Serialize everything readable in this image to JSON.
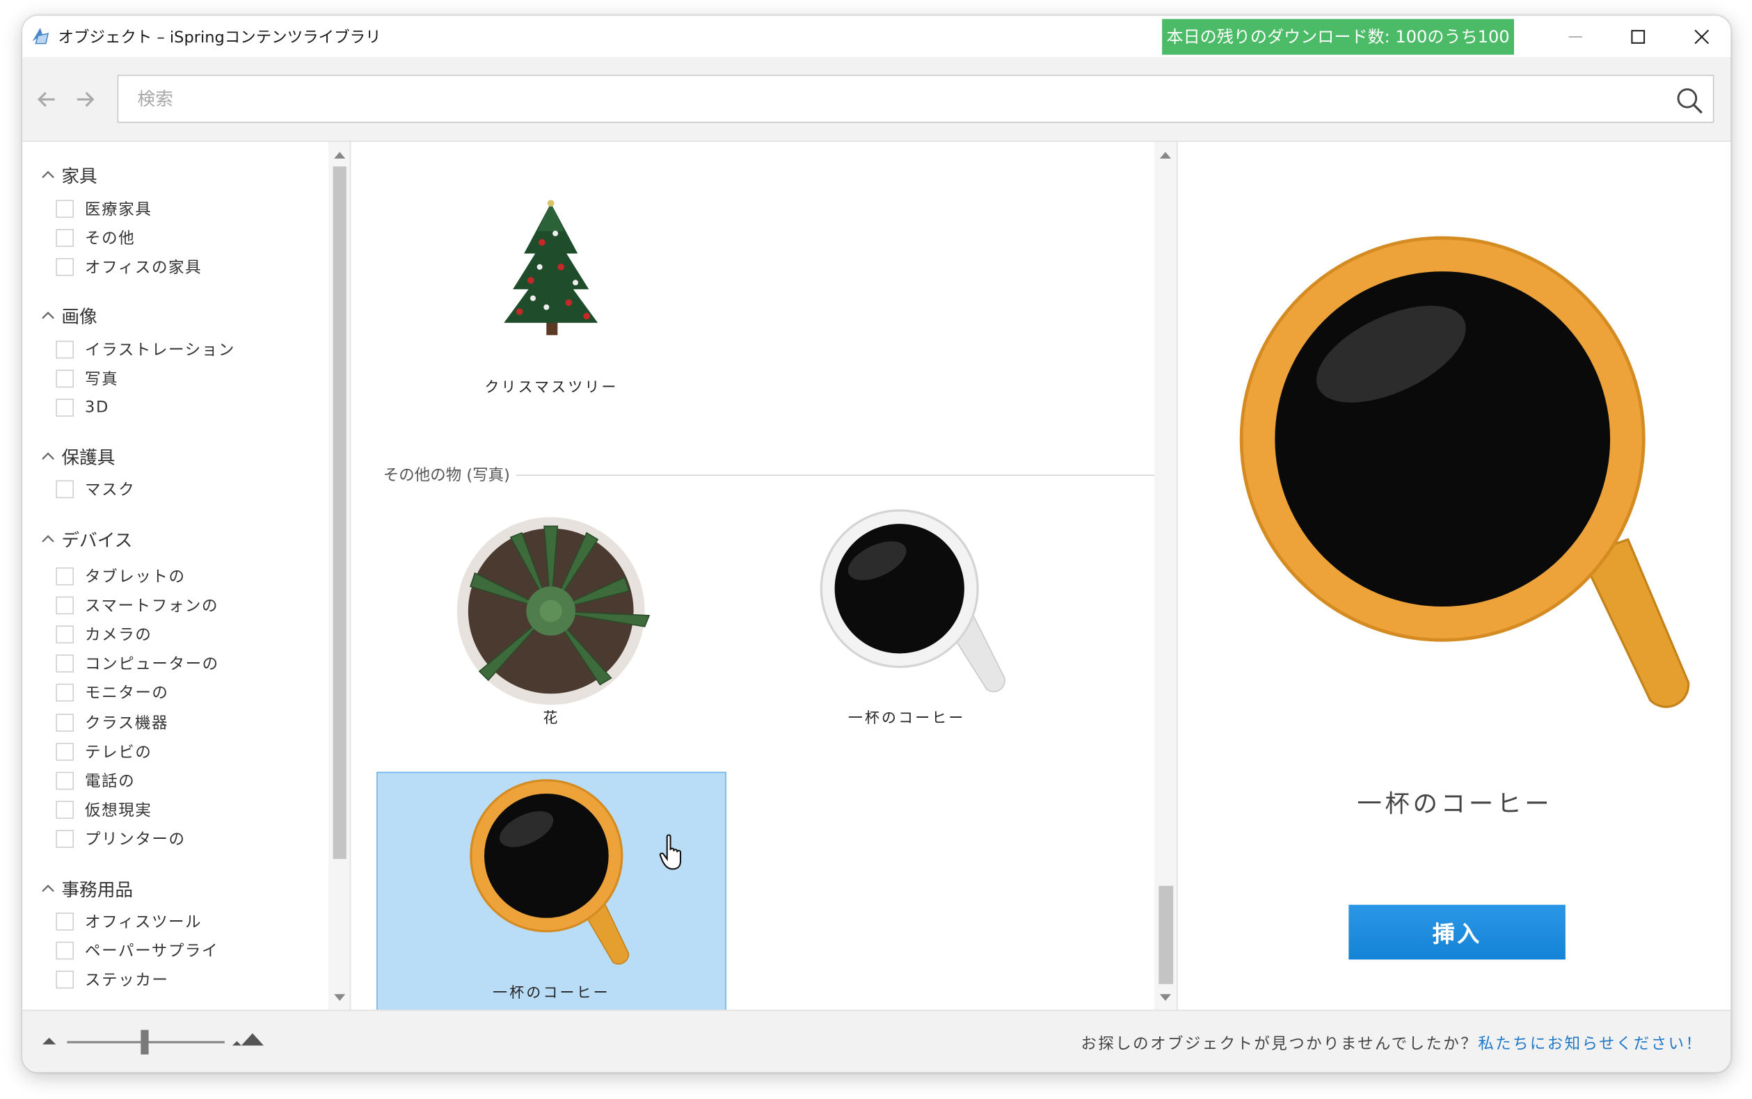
{
  "window": {
    "title": "オブジェクト – iSpringコンテンツライブラリ",
    "download_badge": "本日の残りのダウンロード数: 100のうち100"
  },
  "search": {
    "placeholder": "検索",
    "value": ""
  },
  "sidebar": {
    "categories": [
      {
        "label": "家具",
        "items": [
          "医療家具",
          "その他",
          "オフィスの家具"
        ]
      },
      {
        "label": "画像",
        "items": [
          "イラストレーション",
          "写真",
          "3D"
        ]
      },
      {
        "label": "保護具",
        "items": [
          "マスク"
        ]
      },
      {
        "label": "デバイス",
        "items": [
          "タブレットの",
          "スマートフォンの",
          "カメラの",
          "コンピューターの",
          "モニターの",
          "クラス機器",
          "テレビの",
          "電話の",
          "仮想現実",
          "プリンターの"
        ]
      },
      {
        "label": "事務用品",
        "items": [
          "オフィスツール",
          "ペーパーサプライ",
          "ステッカー"
        ]
      }
    ]
  },
  "gallery": {
    "section_label": "その他の物 (写真)",
    "items": [
      {
        "caption": "クリスマスツリー",
        "icon": "christmas-tree"
      },
      {
        "caption": "花",
        "icon": "succulent-plant"
      },
      {
        "caption": "一杯のコーヒー",
        "icon": "coffee-cup-white"
      },
      {
        "caption": "一杯のコーヒー",
        "icon": "coffee-cup-orange",
        "selected": true
      }
    ]
  },
  "preview": {
    "title": "一杯のコーヒー",
    "insert_label": "挿入"
  },
  "status": {
    "message": "お探しのオブジェクトが見つかりませんでしたか？",
    "link": "私たちにお知らせください！"
  },
  "colors": {
    "badge": "#4cbb67",
    "selection": "#b9dcf7",
    "accent": "#1f78c8",
    "insert_button": "#1583d6"
  }
}
